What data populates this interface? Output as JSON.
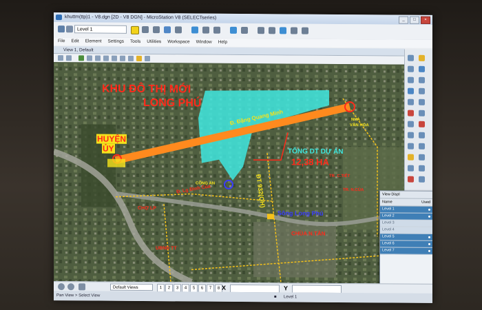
{
  "window": {
    "title": "khuttm(ttp)1 - V8.dgn [2D - V8 DGN] - MicroStation V8 (SELECTseries)",
    "controls": [
      "_",
      "□",
      "×"
    ]
  },
  "toolbar": {
    "level_select": "Level 1",
    "active_color": "#f2d21a"
  },
  "menu": [
    "File",
    "Edit",
    "Element",
    "Settings",
    "Tools",
    "Utilities",
    "Workspace",
    "Window",
    "Help"
  ],
  "view": {
    "title": "View 1, Default"
  },
  "map": {
    "labels": {
      "khu_do_thi": "KHU ĐÔ THỊ MỚI",
      "long_phu": "LONG PHÚ",
      "huyen_uy_1": "HUYỆN",
      "huyen_uy_2": "ỦY",
      "street_dang_quang_minh": "Đ. Đặng Quang Minh",
      "tong_dt": "TỔNG DT DỰ ÁN",
      "area": "12,38 HA",
      "road_dt932": "ĐT 932(QH)",
      "street_lg_dinh_cua": "Đ. Lg Đình Của",
      "cho_lp": "CHỢ LP",
      "song_long_phu": "Sông Long Phú",
      "chua_nitan": "CHÙA N.TÂN",
      "ubnd_tt": "UBND TT",
      "nha_van_hoa": "NHÀ",
      "nha_van_hoa_2": "VĂN HÓA",
      "cong_an": "CÔNG AN",
      "tr_c_tiet": "TR. C.TIẾT",
      "tr_nguyen": "TR. N.CỦA",
      "colors": {
        "project_area": "#3fe8e0",
        "main_road": "#ff8a1e",
        "labels_red": "#ff2a1a",
        "labels_yellow": "#f5e21c",
        "labels_blue": "#3a3cff"
      }
    }
  },
  "level_panel": {
    "title": "View Displ",
    "filter": "Name",
    "used": "Used",
    "levels": [
      {
        "name": "Level 1",
        "active": true
      },
      {
        "name": "Level 2",
        "active": true
      },
      {
        "name": "Level 3",
        "active": false
      },
      {
        "name": "Level 4",
        "active": false
      },
      {
        "name": "Level 5",
        "active": true
      },
      {
        "name": "Level 6",
        "active": true
      },
      {
        "name": "Level 7",
        "active": true
      }
    ]
  },
  "bottom": {
    "views_select": "Default Views",
    "view_numbers": [
      "1",
      "2",
      "3",
      "4",
      "5",
      "6",
      "7",
      "8"
    ],
    "x_label": "X",
    "y_label": "Y"
  },
  "status": {
    "prompt": "Pan View > Select View",
    "level": "Level 1"
  }
}
